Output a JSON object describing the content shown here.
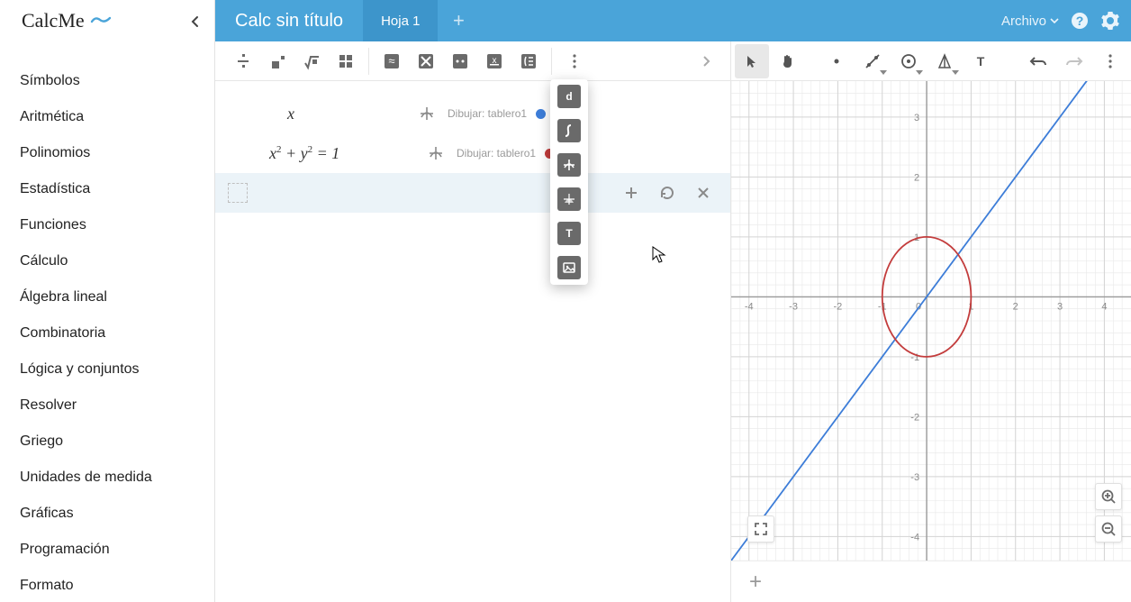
{
  "app": {
    "logo": "CalcMe"
  },
  "sidebar": {
    "items": [
      {
        "label": "Símbolos"
      },
      {
        "label": "Aritmética"
      },
      {
        "label": "Polinomios"
      },
      {
        "label": "Estadística"
      },
      {
        "label": "Funciones"
      },
      {
        "label": "Cálculo"
      },
      {
        "label": "Álgebra lineal"
      },
      {
        "label": "Combinatoria"
      },
      {
        "label": "Lógica y conjuntos"
      },
      {
        "label": "Resolver"
      },
      {
        "label": "Griego"
      },
      {
        "label": "Unidades de medida"
      },
      {
        "label": "Gráficas"
      },
      {
        "label": "Programación"
      },
      {
        "label": "Formato"
      }
    ]
  },
  "header": {
    "title": "Calc sin título",
    "tab": "Hoja 1",
    "file_menu": "Archivo"
  },
  "expressions": [
    {
      "math_html": "x",
      "draw_label": "Dibujar: tablero1",
      "color": "#3d7dd8"
    },
    {
      "math_html": "x<sup>2</sup> + y<sup>2</sup> = 1",
      "draw_label": "Dibujar: tablero1",
      "color": "#c33c3c"
    }
  ],
  "chart_data": {
    "type": "line",
    "title": "",
    "xlabel": "",
    "ylabel": "",
    "xlim": [
      -4.4,
      4.6
    ],
    "ylim": [
      -4.4,
      3.6
    ],
    "x_ticks": [
      -4,
      -3,
      -2,
      -1,
      1,
      2,
      3,
      4
    ],
    "y_ticks": [
      -4,
      -3,
      -2,
      -1,
      1,
      2,
      3
    ],
    "series": [
      {
        "name": "y = x",
        "type": "line",
        "color": "#3d7dd8",
        "points": [
          [
            -5,
            -5
          ],
          [
            5,
            5
          ]
        ]
      },
      {
        "name": "x^2 + y^2 = 1",
        "type": "circle",
        "color": "#c33c3c",
        "cx": 0,
        "cy": 0,
        "r": 1
      }
    ]
  },
  "colors": {
    "primary": "#4aa4d9",
    "tab_active": "#3d95cb",
    "blue_dot": "#3d7dd8",
    "red_dot": "#c33c3c"
  }
}
